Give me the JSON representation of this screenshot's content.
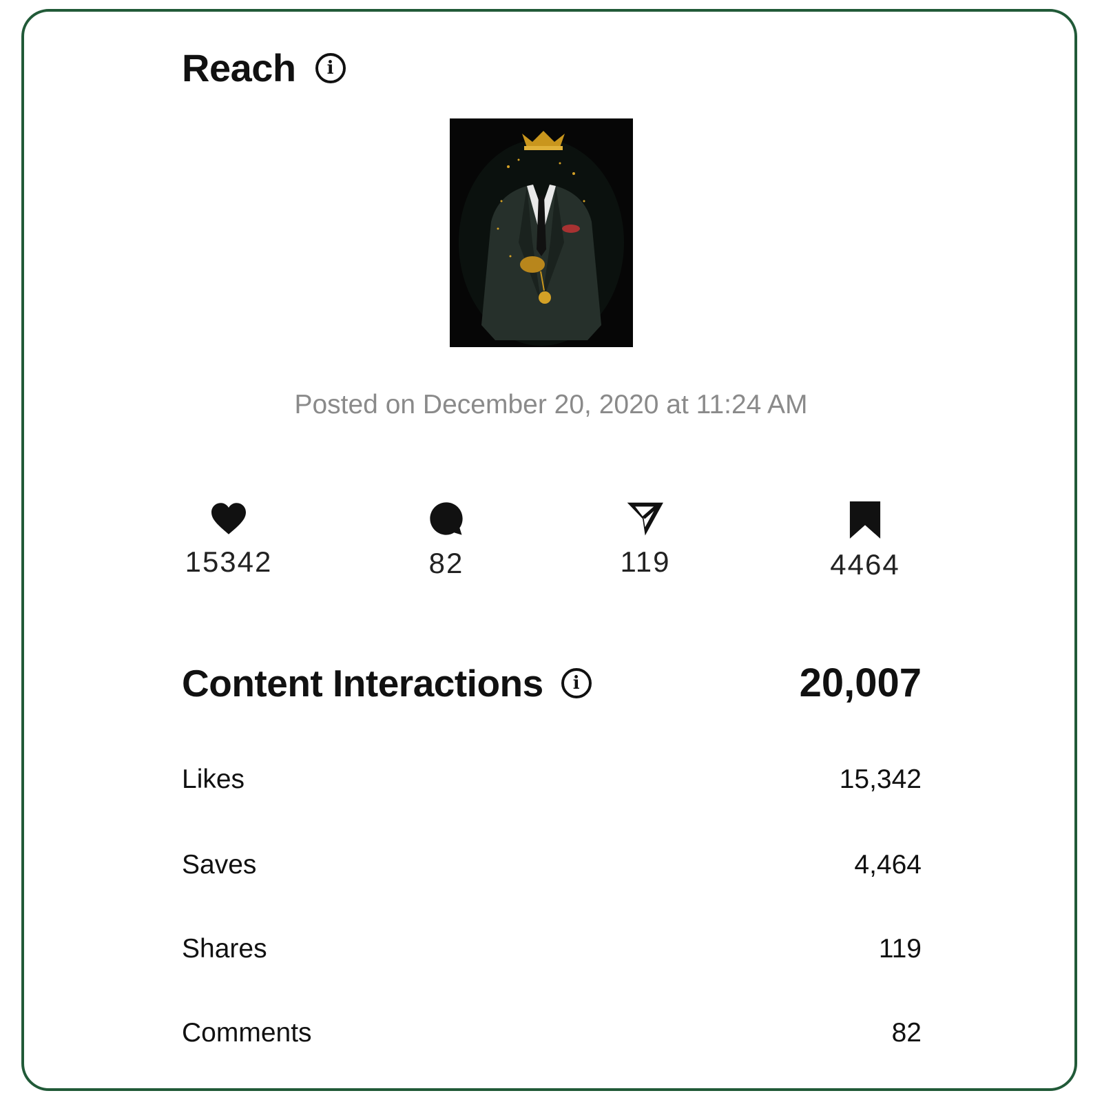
{
  "reach": {
    "title": "Reach",
    "info_icon": "info-icon",
    "posted_on": "Posted on December 20, 2020 at 11:24 AM"
  },
  "stats": [
    {
      "icon": "heart-icon",
      "value": "15342"
    },
    {
      "icon": "comment-icon",
      "value": "82"
    },
    {
      "icon": "share-icon",
      "value": "119"
    },
    {
      "icon": "bookmark-icon",
      "value": "4464"
    }
  ],
  "content_interactions": {
    "title": "Content Interactions",
    "info_icon": "info-icon",
    "total": "20,007",
    "rows": [
      {
        "label": "Likes",
        "value": "15,342"
      },
      {
        "label": "Saves",
        "value": "4,464"
      },
      {
        "label": "Shares",
        "value": "119"
      },
      {
        "label": "Comments",
        "value": "82"
      }
    ]
  },
  "colors": {
    "border": "#215a38",
    "muted_text": "#8a8a8a",
    "text": "#111111"
  }
}
